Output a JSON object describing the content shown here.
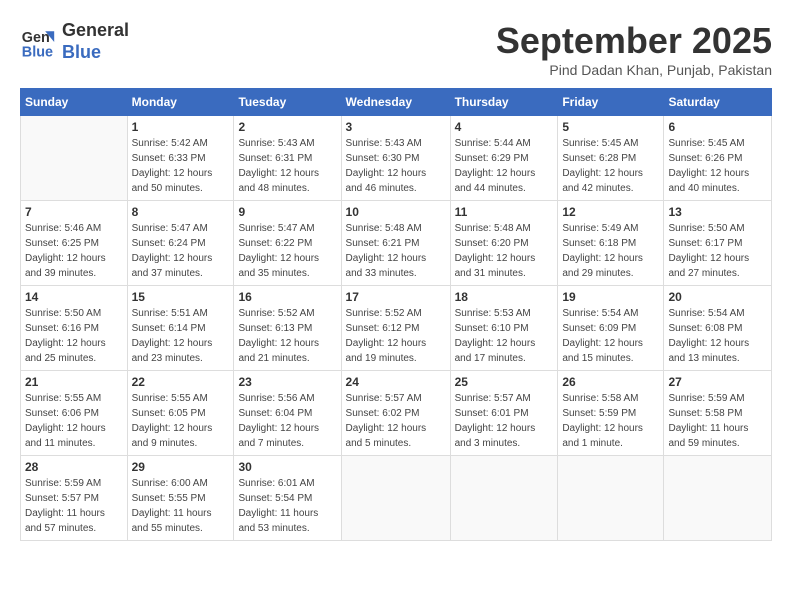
{
  "header": {
    "logo_line1": "General",
    "logo_line2": "Blue",
    "month_title": "September 2025",
    "subtitle": "Pind Dadan Khan, Punjab, Pakistan"
  },
  "days_of_week": [
    "Sunday",
    "Monday",
    "Tuesday",
    "Wednesday",
    "Thursday",
    "Friday",
    "Saturday"
  ],
  "weeks": [
    [
      {
        "day": "",
        "sunrise": "",
        "sunset": "",
        "daylight": ""
      },
      {
        "day": "1",
        "sunrise": "Sunrise: 5:42 AM",
        "sunset": "Sunset: 6:33 PM",
        "daylight": "Daylight: 12 hours and 50 minutes."
      },
      {
        "day": "2",
        "sunrise": "Sunrise: 5:43 AM",
        "sunset": "Sunset: 6:31 PM",
        "daylight": "Daylight: 12 hours and 48 minutes."
      },
      {
        "day": "3",
        "sunrise": "Sunrise: 5:43 AM",
        "sunset": "Sunset: 6:30 PM",
        "daylight": "Daylight: 12 hours and 46 minutes."
      },
      {
        "day": "4",
        "sunrise": "Sunrise: 5:44 AM",
        "sunset": "Sunset: 6:29 PM",
        "daylight": "Daylight: 12 hours and 44 minutes."
      },
      {
        "day": "5",
        "sunrise": "Sunrise: 5:45 AM",
        "sunset": "Sunset: 6:28 PM",
        "daylight": "Daylight: 12 hours and 42 minutes."
      },
      {
        "day": "6",
        "sunrise": "Sunrise: 5:45 AM",
        "sunset": "Sunset: 6:26 PM",
        "daylight": "Daylight: 12 hours and 40 minutes."
      }
    ],
    [
      {
        "day": "7",
        "sunrise": "Sunrise: 5:46 AM",
        "sunset": "Sunset: 6:25 PM",
        "daylight": "Daylight: 12 hours and 39 minutes."
      },
      {
        "day": "8",
        "sunrise": "Sunrise: 5:47 AM",
        "sunset": "Sunset: 6:24 PM",
        "daylight": "Daylight: 12 hours and 37 minutes."
      },
      {
        "day": "9",
        "sunrise": "Sunrise: 5:47 AM",
        "sunset": "Sunset: 6:22 PM",
        "daylight": "Daylight: 12 hours and 35 minutes."
      },
      {
        "day": "10",
        "sunrise": "Sunrise: 5:48 AM",
        "sunset": "Sunset: 6:21 PM",
        "daylight": "Daylight: 12 hours and 33 minutes."
      },
      {
        "day": "11",
        "sunrise": "Sunrise: 5:48 AM",
        "sunset": "Sunset: 6:20 PM",
        "daylight": "Daylight: 12 hours and 31 minutes."
      },
      {
        "day": "12",
        "sunrise": "Sunrise: 5:49 AM",
        "sunset": "Sunset: 6:18 PM",
        "daylight": "Daylight: 12 hours and 29 minutes."
      },
      {
        "day": "13",
        "sunrise": "Sunrise: 5:50 AM",
        "sunset": "Sunset: 6:17 PM",
        "daylight": "Daylight: 12 hours and 27 minutes."
      }
    ],
    [
      {
        "day": "14",
        "sunrise": "Sunrise: 5:50 AM",
        "sunset": "Sunset: 6:16 PM",
        "daylight": "Daylight: 12 hours and 25 minutes."
      },
      {
        "day": "15",
        "sunrise": "Sunrise: 5:51 AM",
        "sunset": "Sunset: 6:14 PM",
        "daylight": "Daylight: 12 hours and 23 minutes."
      },
      {
        "day": "16",
        "sunrise": "Sunrise: 5:52 AM",
        "sunset": "Sunset: 6:13 PM",
        "daylight": "Daylight: 12 hours and 21 minutes."
      },
      {
        "day": "17",
        "sunrise": "Sunrise: 5:52 AM",
        "sunset": "Sunset: 6:12 PM",
        "daylight": "Daylight: 12 hours and 19 minutes."
      },
      {
        "day": "18",
        "sunrise": "Sunrise: 5:53 AM",
        "sunset": "Sunset: 6:10 PM",
        "daylight": "Daylight: 12 hours and 17 minutes."
      },
      {
        "day": "19",
        "sunrise": "Sunrise: 5:54 AM",
        "sunset": "Sunset: 6:09 PM",
        "daylight": "Daylight: 12 hours and 15 minutes."
      },
      {
        "day": "20",
        "sunrise": "Sunrise: 5:54 AM",
        "sunset": "Sunset: 6:08 PM",
        "daylight": "Daylight: 12 hours and 13 minutes."
      }
    ],
    [
      {
        "day": "21",
        "sunrise": "Sunrise: 5:55 AM",
        "sunset": "Sunset: 6:06 PM",
        "daylight": "Daylight: 12 hours and 11 minutes."
      },
      {
        "day": "22",
        "sunrise": "Sunrise: 5:55 AM",
        "sunset": "Sunset: 6:05 PM",
        "daylight": "Daylight: 12 hours and 9 minutes."
      },
      {
        "day": "23",
        "sunrise": "Sunrise: 5:56 AM",
        "sunset": "Sunset: 6:04 PM",
        "daylight": "Daylight: 12 hours and 7 minutes."
      },
      {
        "day": "24",
        "sunrise": "Sunrise: 5:57 AM",
        "sunset": "Sunset: 6:02 PM",
        "daylight": "Daylight: 12 hours and 5 minutes."
      },
      {
        "day": "25",
        "sunrise": "Sunrise: 5:57 AM",
        "sunset": "Sunset: 6:01 PM",
        "daylight": "Daylight: 12 hours and 3 minutes."
      },
      {
        "day": "26",
        "sunrise": "Sunrise: 5:58 AM",
        "sunset": "Sunset: 5:59 PM",
        "daylight": "Daylight: 12 hours and 1 minute."
      },
      {
        "day": "27",
        "sunrise": "Sunrise: 5:59 AM",
        "sunset": "Sunset: 5:58 PM",
        "daylight": "Daylight: 11 hours and 59 minutes."
      }
    ],
    [
      {
        "day": "28",
        "sunrise": "Sunrise: 5:59 AM",
        "sunset": "Sunset: 5:57 PM",
        "daylight": "Daylight: 11 hours and 57 minutes."
      },
      {
        "day": "29",
        "sunrise": "Sunrise: 6:00 AM",
        "sunset": "Sunset: 5:55 PM",
        "daylight": "Daylight: 11 hours and 55 minutes."
      },
      {
        "day": "30",
        "sunrise": "Sunrise: 6:01 AM",
        "sunset": "Sunset: 5:54 PM",
        "daylight": "Daylight: 11 hours and 53 minutes."
      },
      {
        "day": "",
        "sunrise": "",
        "sunset": "",
        "daylight": ""
      },
      {
        "day": "",
        "sunrise": "",
        "sunset": "",
        "daylight": ""
      },
      {
        "day": "",
        "sunrise": "",
        "sunset": "",
        "daylight": ""
      },
      {
        "day": "",
        "sunrise": "",
        "sunset": "",
        "daylight": ""
      }
    ]
  ]
}
